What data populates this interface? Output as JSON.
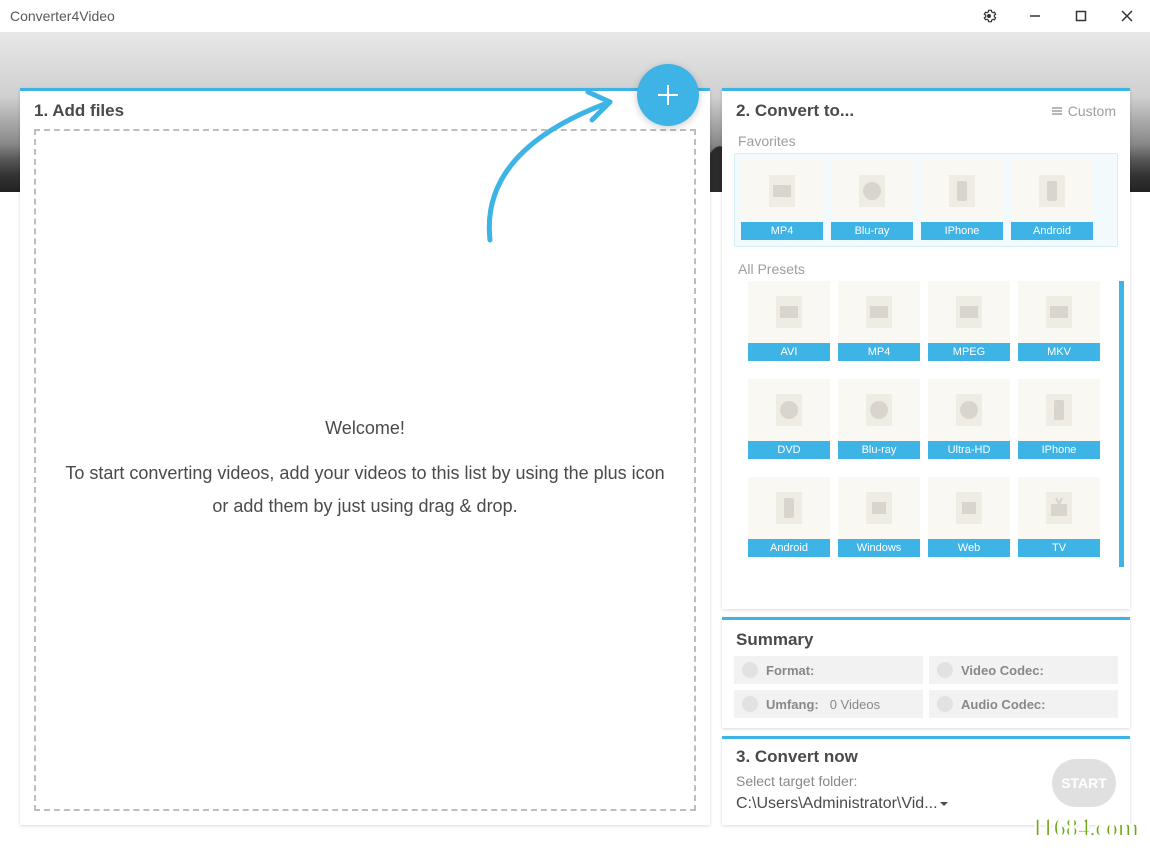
{
  "app_title": "Converter4Video",
  "step1": {
    "title": "1. Add files",
    "welcome": "Welcome!",
    "tip": "To start converting videos, add your videos to this list by using the plus icon or add them by just using drag & drop."
  },
  "step2": {
    "title": "2. Convert to...",
    "custom_label": "Custom",
    "favorites_label": "Favorites",
    "favorites": [
      "MP4",
      "Blu-ray",
      "IPhone",
      "Android"
    ],
    "all_presets_label": "All Presets",
    "all_presets": [
      [
        "AVI",
        "MP4",
        "MPEG",
        "MKV"
      ],
      [
        "DVD",
        "Blu-ray",
        "Ultra-HD",
        "IPhone"
      ],
      [
        "Android",
        "Windows",
        "Web",
        "TV"
      ]
    ]
  },
  "summary": {
    "title": "Summary",
    "format_label": "Format:",
    "format_value": "",
    "video_codec_label": "Video Codec:",
    "video_codec_value": "",
    "umfang_label": "Umfang:",
    "umfang_value": "0 Videos",
    "audio_codec_label": "Audio Codec:",
    "audio_codec_value": ""
  },
  "step3": {
    "title": "3. Convert now",
    "target_label": "Select target folder:",
    "target_path": "C:\\Users\\Administrator\\Vid...",
    "start_label": "START"
  },
  "watermark": "11684.com"
}
